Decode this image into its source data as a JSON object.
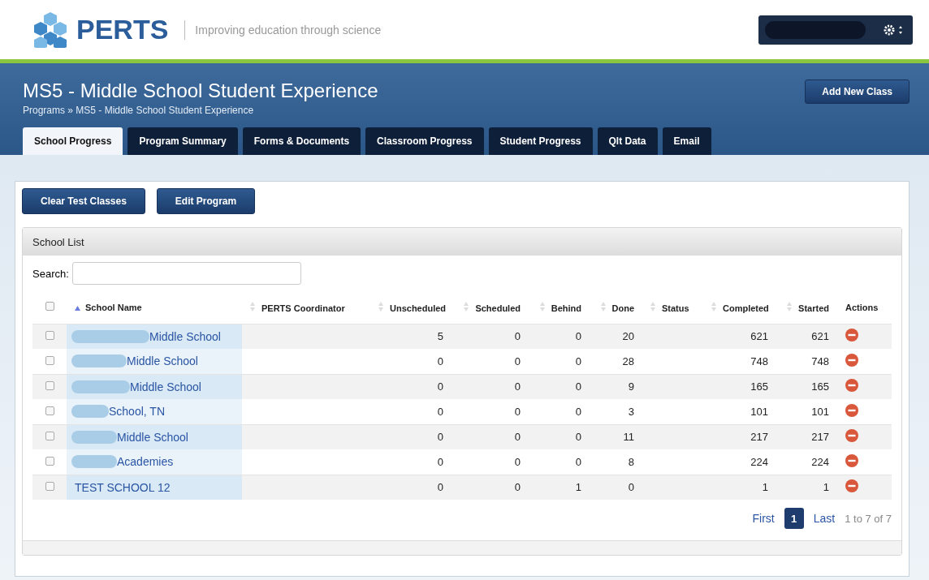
{
  "header": {
    "logo": "PERTS",
    "tagline": "Improving education through science",
    "user": {
      "name_redacted": true
    }
  },
  "program": {
    "title": "MS5 - Middle School Student Experience",
    "breadcrumb": "Programs » MS5 - Middle School Student Experience",
    "add_button": "Add New Class"
  },
  "tabs": [
    {
      "label": "School Progress",
      "selected": true
    },
    {
      "label": "Program Summary",
      "selected": false
    },
    {
      "label": "Forms & Documents",
      "selected": false
    },
    {
      "label": "Classroom Progress",
      "selected": false
    },
    {
      "label": "Student Progress",
      "selected": false
    },
    {
      "label": "Qlt Data",
      "selected": false
    },
    {
      "label": "Email",
      "selected": false
    }
  ],
  "actions": [
    "Clear Test Classes",
    "Edit Program"
  ],
  "panel": {
    "title": "School List",
    "search_label": "Search:",
    "select_all_checked": false,
    "columns": [
      {
        "label": "School Name",
        "sortable": true,
        "sorted": true
      },
      {
        "label": "PERTS Coordinator",
        "sortable": true,
        "sorted": false
      },
      {
        "label": "Unscheduled",
        "sortable": true,
        "sorted": false
      },
      {
        "label": "Scheduled",
        "sortable": true,
        "sorted": false
      },
      {
        "label": "Behind",
        "sortable": true,
        "sorted": false
      },
      {
        "label": "Done",
        "sortable": true,
        "sorted": false
      },
      {
        "label": "Status",
        "sortable": true,
        "sorted": false
      },
      {
        "label": "Completed",
        "sortable": true,
        "sorted": false
      },
      {
        "label": "Started",
        "sortable": true,
        "sorted": false
      },
      {
        "label": "Actions",
        "sortable": false
      }
    ],
    "rows": [
      {
        "checked": false,
        "redacted": true,
        "name": "Middle School",
        "unscheduled": "5",
        "scheduled": "0",
        "behind": "0",
        "done": "20",
        "completed": "621",
        "started": "621"
      },
      {
        "checked": false,
        "redacted": true,
        "name": "Middle School",
        "unscheduled": "0",
        "scheduled": "0",
        "behind": "0",
        "done": "28",
        "completed": "748",
        "started": "748"
      },
      {
        "checked": false,
        "redacted": true,
        "name": "Middle School",
        "unscheduled": "0",
        "scheduled": "0",
        "behind": "0",
        "done": "9",
        "completed": "165",
        "started": "165"
      },
      {
        "checked": false,
        "redacted": true,
        "name": "School, TN",
        "unscheduled": "0",
        "scheduled": "0",
        "behind": "0",
        "done": "3",
        "completed": "101",
        "started": "101"
      },
      {
        "checked": false,
        "redacted": true,
        "name": "Middle School",
        "unscheduled": "0",
        "scheduled": "0",
        "behind": "0",
        "done": "11",
        "completed": "217",
        "started": "217"
      },
      {
        "checked": false,
        "redacted": true,
        "name": "Academies",
        "unscheduled": "0",
        "scheduled": "0",
        "behind": "0",
        "done": "8",
        "completed": "224",
        "started": "224"
      },
      {
        "checked": false,
        "redacted": false,
        "name": "TEST SCHOOL 12",
        "unscheduled": "0",
        "scheduled": "0",
        "behind": "1",
        "done": "0",
        "completed": "1",
        "started": "1"
      }
    ],
    "pagination": {
      "first": "First",
      "pages": [
        {
          "label": "1",
          "selected": true
        }
      ],
      "last": "Last",
      "summary": "1 to 7 of 7"
    }
  }
}
